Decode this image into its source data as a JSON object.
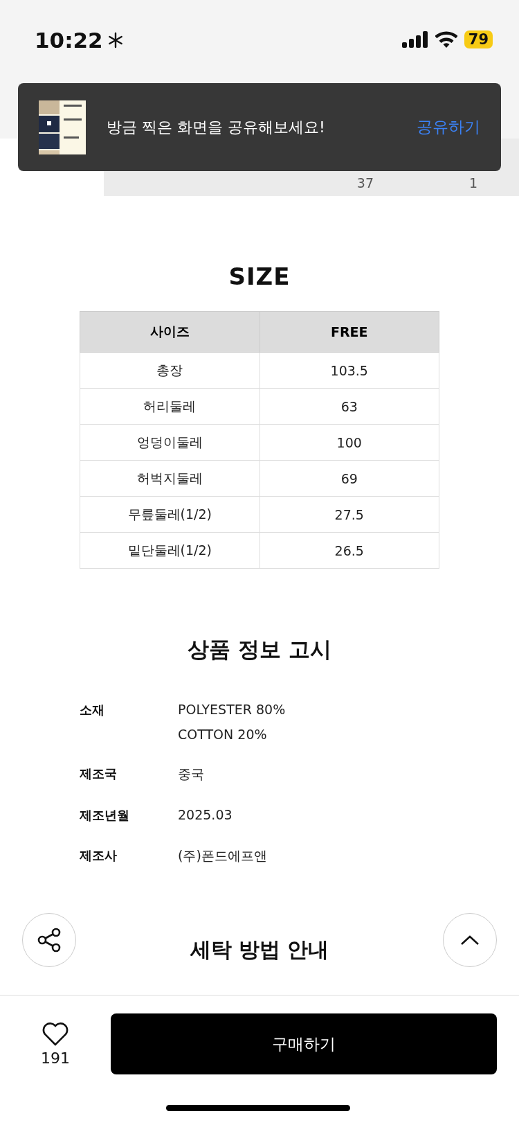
{
  "status_bar": {
    "time": "10:22",
    "battery": "79",
    "low_power": true
  },
  "toast": {
    "message": "방금 찍은 화면을 공유해보세요!",
    "action": "공유하기"
  },
  "tab_strip": {
    "counts": [
      "37",
      "1"
    ]
  },
  "size_chart": {
    "title": "SIZE",
    "columns": [
      "사이즈",
      "FREE"
    ],
    "rows": [
      [
        "총장",
        "103.5"
      ],
      [
        "허리둘레",
        "63"
      ],
      [
        "엉덩이둘레",
        "100"
      ],
      [
        "허벅지둘레",
        "69"
      ],
      [
        "무릎둘레(1/2)",
        "27.5"
      ],
      [
        "밑단둘레(1/2)",
        "26.5"
      ]
    ]
  },
  "product_info": {
    "title": "상품 정보 고시",
    "rows": [
      {
        "label": "소재",
        "values": [
          "POLYESTER 80%",
          "COTTON 20%"
        ]
      },
      {
        "label": "제조국",
        "values": [
          "중국"
        ]
      },
      {
        "label": "제조년월",
        "values": [
          "2025.03"
        ]
      },
      {
        "label": "제조사",
        "values": [
          "(주)폰드에프앤"
        ]
      }
    ]
  },
  "care_title": "세탁 방법 안내",
  "bottom_bar": {
    "likes": "191",
    "liked": false,
    "buy_label": "구매하기"
  }
}
